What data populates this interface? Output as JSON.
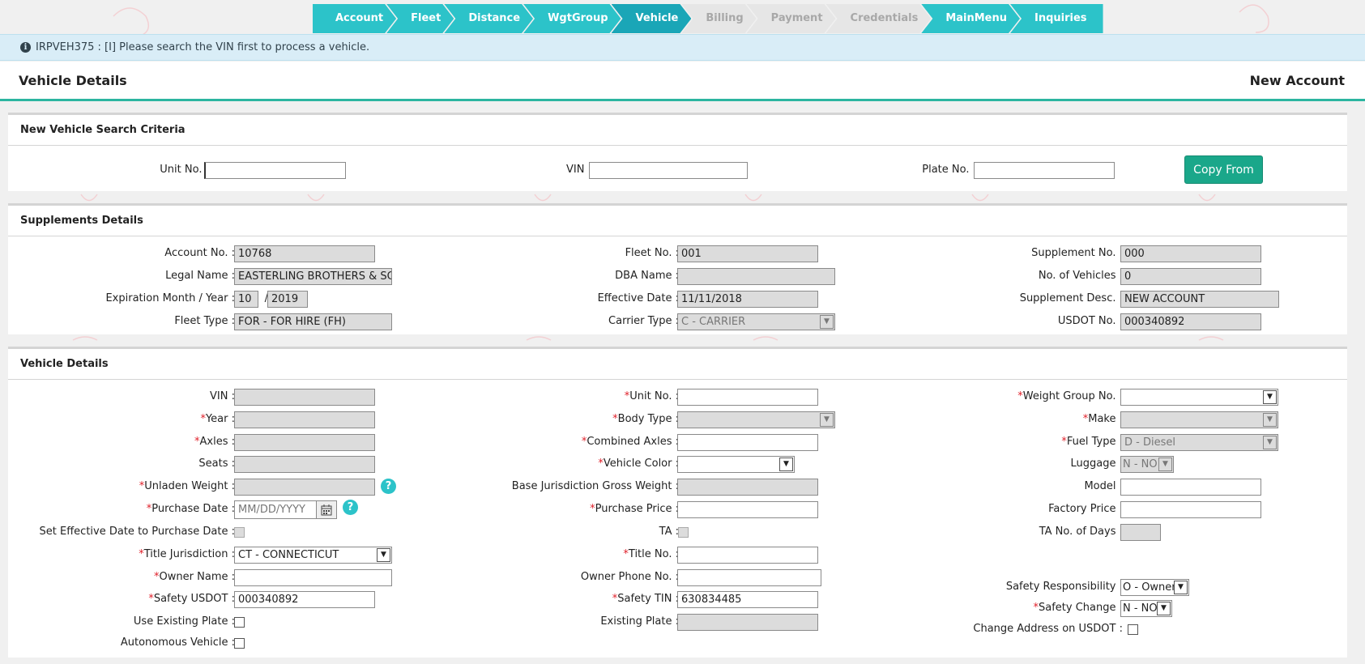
{
  "wizard": {
    "steps": [
      {
        "label": "Account",
        "state": "done"
      },
      {
        "label": "Fleet",
        "state": "done"
      },
      {
        "label": "Distance",
        "state": "done"
      },
      {
        "label": "WgtGroup",
        "state": "done"
      },
      {
        "label": "Vehicle",
        "state": "active"
      },
      {
        "label": "Billing",
        "state": "disabled"
      },
      {
        "label": "Payment",
        "state": "disabled"
      },
      {
        "label": "Credentials",
        "state": "disabled"
      },
      {
        "label": "MainMenu",
        "state": "done"
      },
      {
        "label": "Inquiries",
        "state": "done"
      }
    ]
  },
  "info": {
    "message": "IRPVEH375 : [I] Please search the VIN first to process a vehicle.",
    "icon": "info-icon"
  },
  "header": {
    "title": "Vehicle Details",
    "account_type": "New Account"
  },
  "search": {
    "title": "New Vehicle Search Criteria",
    "unit_label": "Unit No. :",
    "unit_value": "",
    "vin_label": "VIN :",
    "vin_value": "",
    "plate_label": "Plate No. :",
    "plate_value": "",
    "copy_button": "Copy From"
  },
  "supplements": {
    "title": "Supplements Details",
    "account_label": "Account No. :",
    "account_value": "10768",
    "legal_label": "Legal Name :",
    "legal_value": "EASTERLING BROTHERS & SON",
    "exp_label": "Expiration Month / Year :",
    "exp_month": "10",
    "exp_sep": "/",
    "exp_year": "2019",
    "fleet_type_label": "Fleet Type :",
    "fleet_type_value": "FOR - FOR HIRE (FH)",
    "fleet_label": "Fleet No. :",
    "fleet_value": "001",
    "dba_label": "DBA Name :",
    "dba_value": "",
    "eff_label": "Effective Date :",
    "eff_value": "11/11/2018",
    "carrier_label": "Carrier Type :",
    "carrier_value": "C - CARRIER",
    "supp_label": "Supplement No. :",
    "supp_value": "000",
    "veh_count_label": "No. of Vehicles :",
    "veh_count_value": "0",
    "supp_desc_label": "Supplement Desc. :",
    "supp_desc_value": "NEW ACCOUNT",
    "usdot_label": "USDOT No. :",
    "usdot_value": "000340892"
  },
  "vehicle": {
    "title": "Vehicle Details",
    "required_mark": "*",
    "help_glyph": "?",
    "vin_label": "VIN :",
    "vin_value": "",
    "year_label": "Year :",
    "year_value": "",
    "axles_label": "Axles :",
    "axles_value": "",
    "seats_label": "Seats :",
    "seats_value": "",
    "unladen_label": "Unladen Weight :",
    "unladen_value": "",
    "pdate_label": "Purchase Date :",
    "pdate_placeholder": "MM/DD/YYYY",
    "set_eff_label": "Set Effective Date to Purchase Date :",
    "title_jur_label": "Title Jurisdiction :",
    "title_jur_value": "CT - CONNECTICUT",
    "owner_label": "Owner Name :",
    "owner_value": "",
    "safety_usdot_label": "Safety USDOT :",
    "safety_usdot_value": "000340892",
    "use_plate_label": "Use Existing Plate :",
    "autonomous_label": "Autonomous Vehicle :",
    "unit_label": "Unit No. :",
    "unit_value": "",
    "body_label": "Body Type :",
    "body_value": "",
    "comb_axles_label": "Combined Axles :",
    "comb_axles_value": "",
    "color_label": "Vehicle Color :",
    "color_value": "",
    "base_gw_label": "Base Jurisdiction Gross Weight :",
    "base_gw_value": "",
    "pprice_label": "Purchase Price :",
    "pprice_value": "",
    "ta_label": "TA :",
    "title_no_label": "Title No. :",
    "title_no_value": "",
    "owner_phone_label": "Owner Phone No. :",
    "owner_phone_value": "",
    "safety_tin_label": "Safety TIN :",
    "safety_tin_value": "630834485",
    "existing_plate_label": "Existing Plate :",
    "existing_plate_value": "",
    "wgroup_label": "Weight Group No. :",
    "wgroup_value": "",
    "make_label": "Make :",
    "make_value": "",
    "fuel_label": "Fuel Type :",
    "fuel_value": "D - Diesel",
    "luggage_label": "Luggage :",
    "luggage_value": "N - NO",
    "model_label": "Model :",
    "model_value": "",
    "factory_label": "Factory Price :",
    "factory_value": "",
    "ta_days_label": "TA No. of Days :",
    "ta_days_value": "",
    "safety_resp_label": "Safety Responsibility :",
    "safety_resp_value": "O - Owner",
    "safety_change_label": "Safety Change :",
    "safety_change_value": "N - NO",
    "change_addr_label": "Change Address on USDOT :"
  }
}
